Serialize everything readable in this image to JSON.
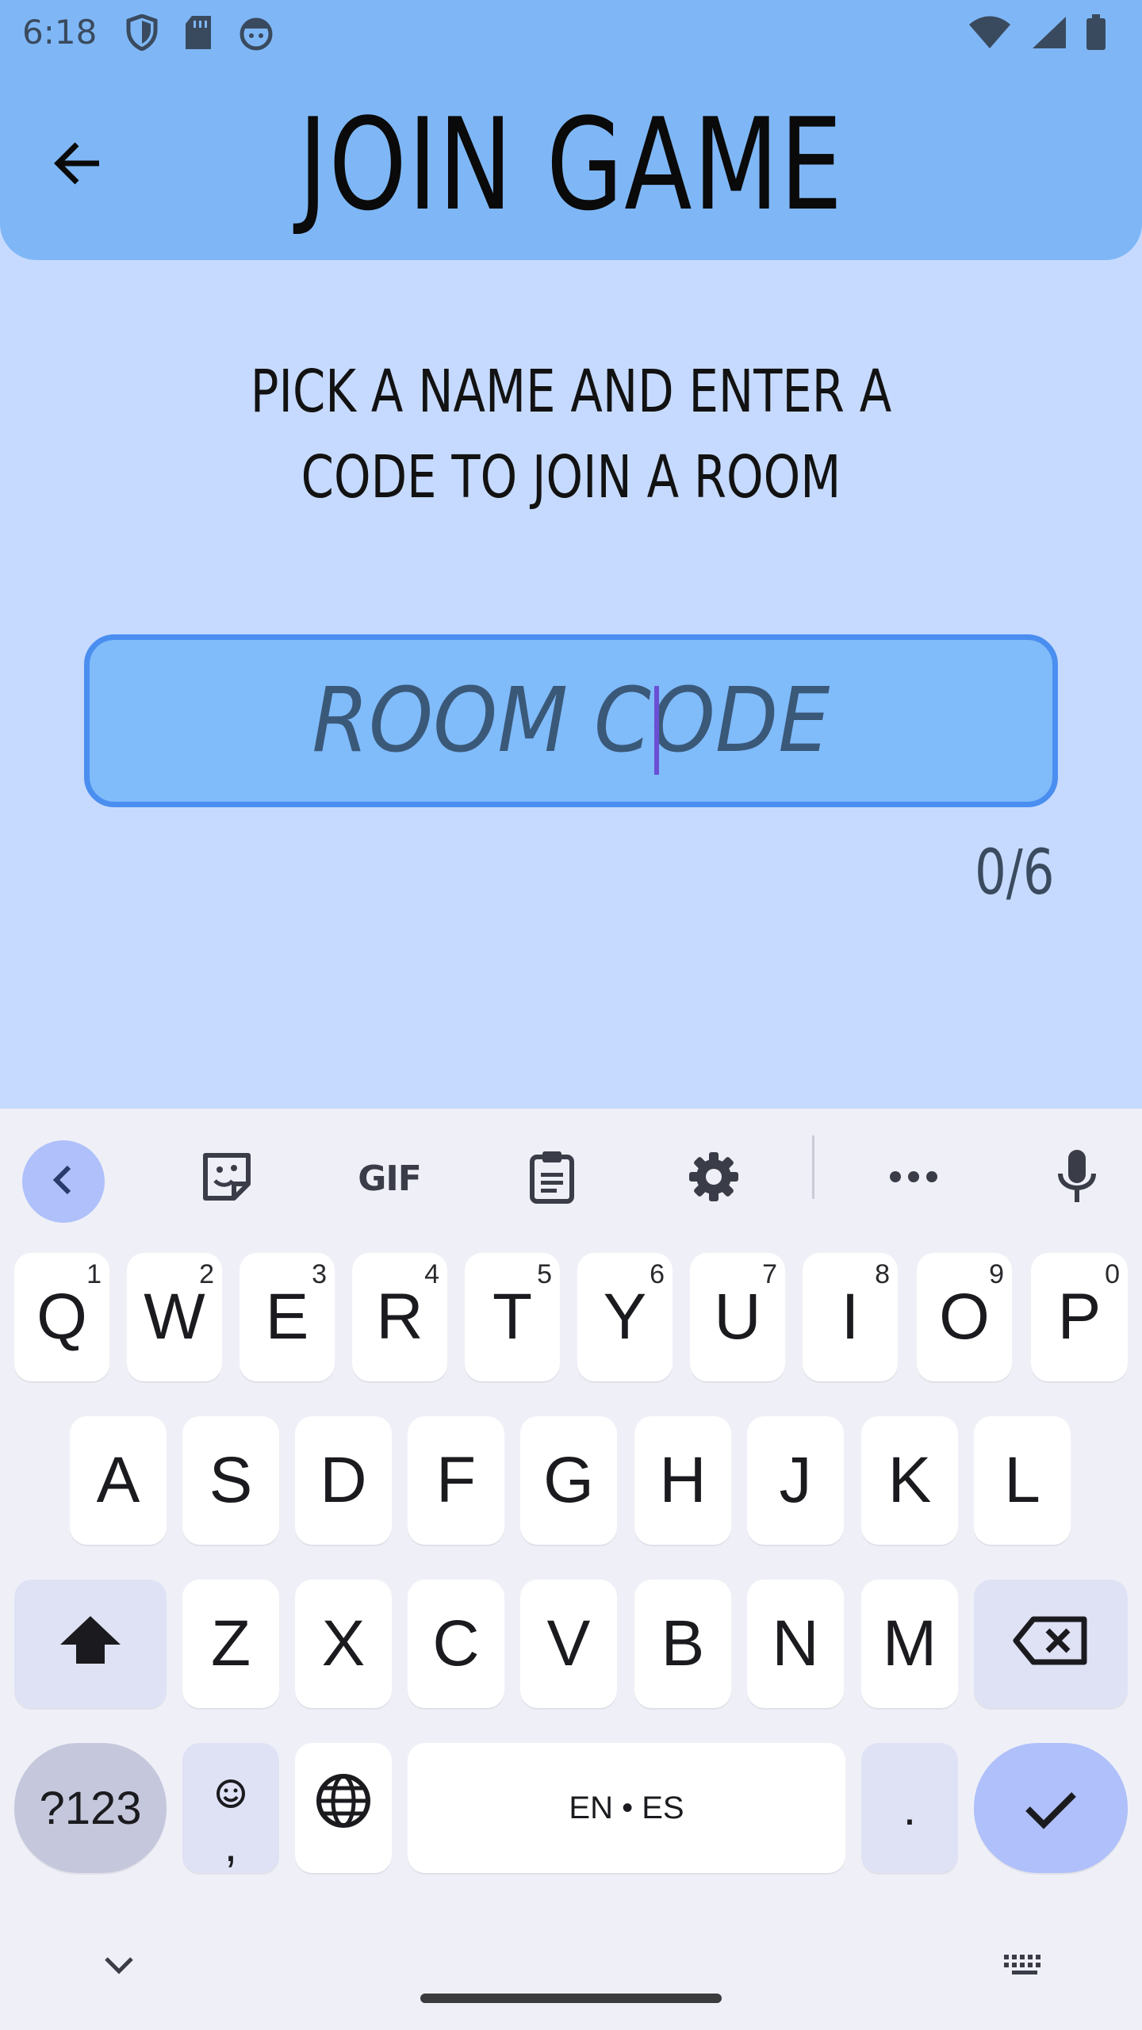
{
  "status_bar": {
    "time": "6:18",
    "icons_left": [
      "shield-icon",
      "sd-card-icon",
      "face-icon"
    ],
    "icons_right": [
      "wifi-icon",
      "signal-icon",
      "battery-icon"
    ]
  },
  "header": {
    "title": "JOIN GAME",
    "back_icon": "arrow-left-icon"
  },
  "main": {
    "instructions": "PICK A NAME AND ENTER A CODE TO JOIN A ROOM",
    "room_code": {
      "placeholder": "ROOM CODE",
      "value": "",
      "counter": "0/6"
    }
  },
  "keyboard": {
    "toolbar": [
      "chevron-left-icon",
      "sticker-icon",
      "GIF",
      "clipboard-icon",
      "gear-icon",
      "more-icon",
      "microphone-icon"
    ],
    "rows": [
      [
        {
          "label": "Q",
          "hint": "1"
        },
        {
          "label": "W",
          "hint": "2"
        },
        {
          "label": "E",
          "hint": "3"
        },
        {
          "label": "R",
          "hint": "4"
        },
        {
          "label": "T",
          "hint": "5"
        },
        {
          "label": "Y",
          "hint": "6"
        },
        {
          "label": "U",
          "hint": "7"
        },
        {
          "label": "I",
          "hint": "8"
        },
        {
          "label": "O",
          "hint": "9"
        },
        {
          "label": "P",
          "hint": "0"
        }
      ],
      [
        {
          "label": "A"
        },
        {
          "label": "S"
        },
        {
          "label": "D"
        },
        {
          "label": "F"
        },
        {
          "label": "G"
        },
        {
          "label": "H"
        },
        {
          "label": "J"
        },
        {
          "label": "K"
        },
        {
          "label": "L"
        }
      ],
      [
        {
          "label": "Z"
        },
        {
          "label": "X"
        },
        {
          "label": "C"
        },
        {
          "label": "V"
        },
        {
          "label": "B"
        },
        {
          "label": "N"
        },
        {
          "label": "M"
        }
      ]
    ],
    "shift_icon": "shift-icon",
    "backspace_icon": "backspace-icon",
    "symbols_label": "?123",
    "emoji_comma_label": ",",
    "globe_icon": "globe-icon",
    "space_label": "EN • ES",
    "period_label": ".",
    "enter_icon": "checkmark-icon"
  },
  "nav_bar": {
    "hide_keyboard_icon": "chevron-down-icon",
    "keyboard_switch_icon": "keyboard-icon"
  },
  "colors": {
    "header_bg": "#7fb7f6",
    "page_bg": "#c6daff",
    "field_bg": "#80bbfa",
    "field_border": "#4a8ef0",
    "keyboard_bg": "#eff0f7",
    "accent_key": "#afc0fb"
  }
}
